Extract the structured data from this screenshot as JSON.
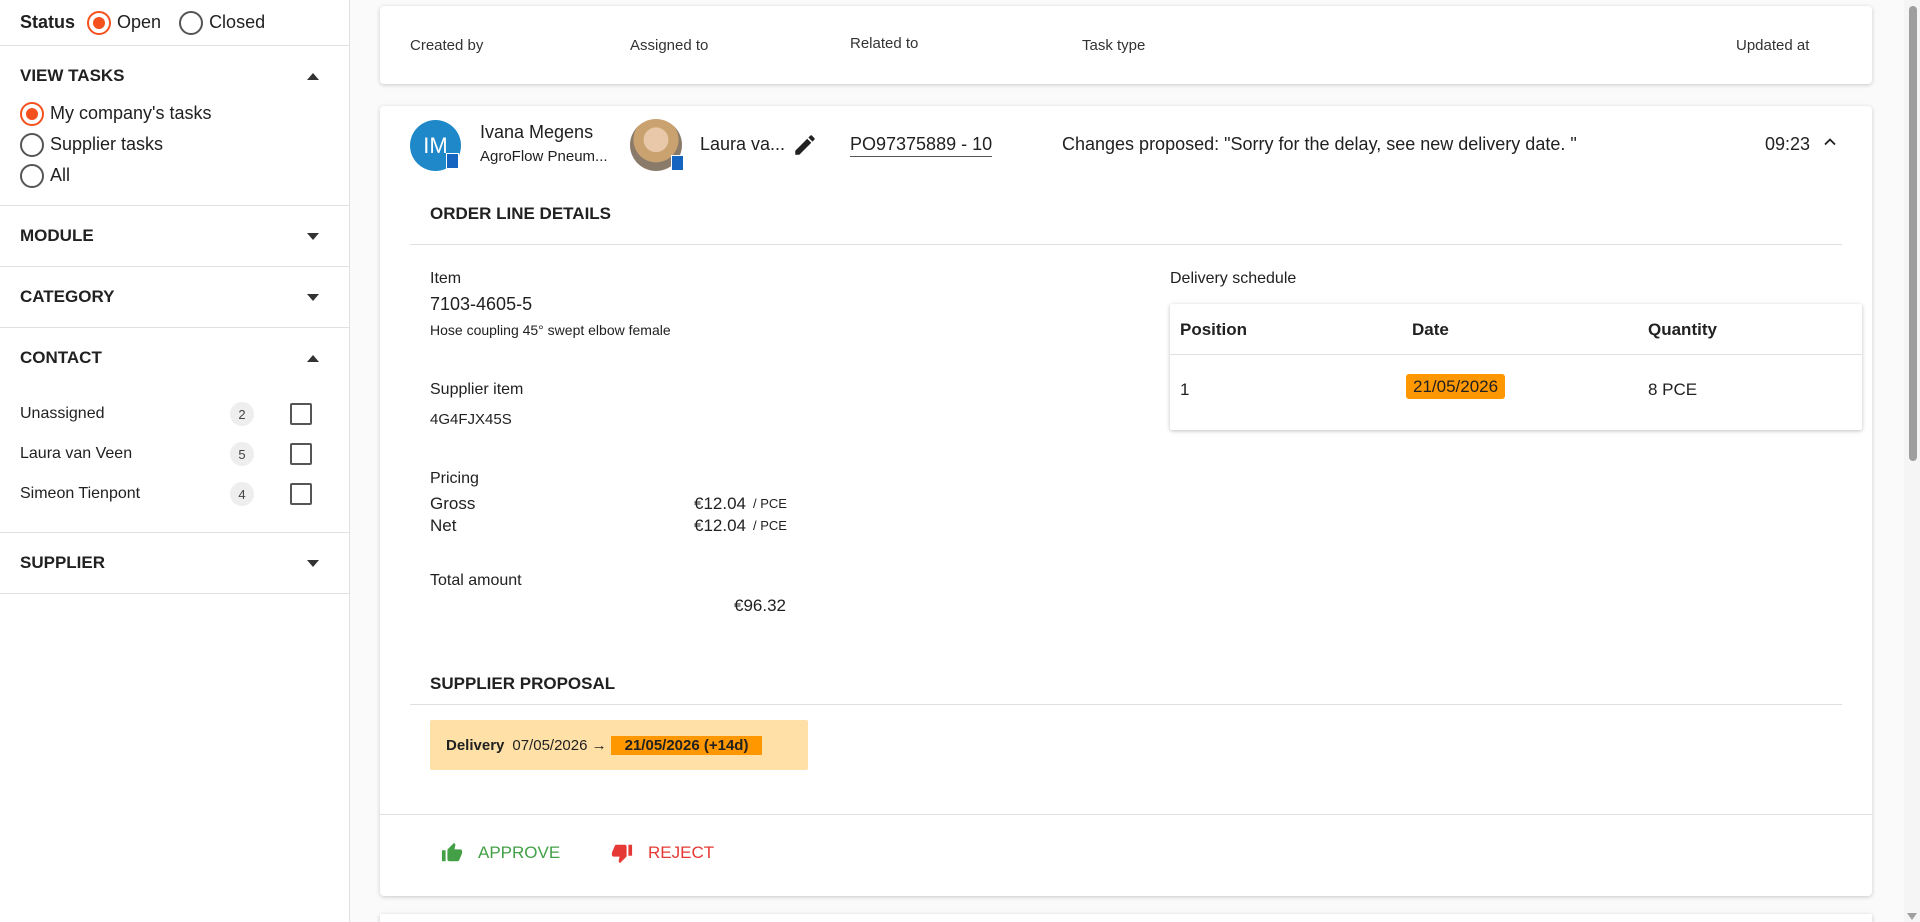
{
  "sidebar": {
    "status_label": "Status",
    "status_open": "Open",
    "status_closed": "Closed",
    "view_tasks": {
      "title": "VIEW TASKS",
      "options": [
        "My company's tasks",
        "Supplier tasks",
        "All"
      ],
      "selected": "My company's tasks"
    },
    "module": "MODULE",
    "category": "CATEGORY",
    "contact": {
      "title": "CONTACT",
      "items": [
        {
          "name": "Unassigned",
          "count": "2"
        },
        {
          "name": "Laura van Veen",
          "count": "5"
        },
        {
          "name": "Simeon Tienpont",
          "count": "4"
        }
      ]
    },
    "supplier": "SUPPLIER"
  },
  "header": {
    "created_by": "Created by",
    "assigned_to": "Assigned to",
    "related_to": "Related to",
    "task_type": "Task type",
    "updated_at": "Updated at"
  },
  "task": {
    "creator_initials": "IM",
    "creator_name": "Ivana Megens",
    "creator_org": "AgroFlow Pneum...",
    "assignee": "Laura va...",
    "related": "PO97375889 - 10",
    "task_type": "Changes proposed: \"Sorry for the delay, see new delivery date. \"",
    "updated": "09:23",
    "details": {
      "title": "ORDER LINE DETAILS",
      "item_label": "Item",
      "item_code": "7103-4605-5",
      "item_desc": "Hose coupling 45° swept elbow female",
      "supplier_item_label": "Supplier item",
      "supplier_item": "4G4FJX45S",
      "pricing_label": "Pricing",
      "gross_label": "Gross",
      "gross_value": "€12.04",
      "net_label": "Net",
      "net_value": "€12.04",
      "unit": "/ PCE",
      "total_label": "Total amount",
      "total_value": "€96.32"
    },
    "schedule": {
      "label": "Delivery schedule",
      "headers": [
        "Position",
        "Date",
        "Quantity"
      ],
      "rows": [
        {
          "position": "1",
          "date": "21/05/2026",
          "quantity": "8 PCE"
        }
      ]
    },
    "proposal": {
      "title": "SUPPLIER PROPOSAL",
      "key": "Delivery",
      "old": "07/05/2026 →",
      "new": "21/05/2026 (+14d)"
    },
    "approve": "APPROVE",
    "reject": "REJECT"
  },
  "colors": {
    "accent": "#f4511e",
    "highlight": "#ff9800",
    "approve": "#43a047",
    "reject": "#e53935"
  }
}
